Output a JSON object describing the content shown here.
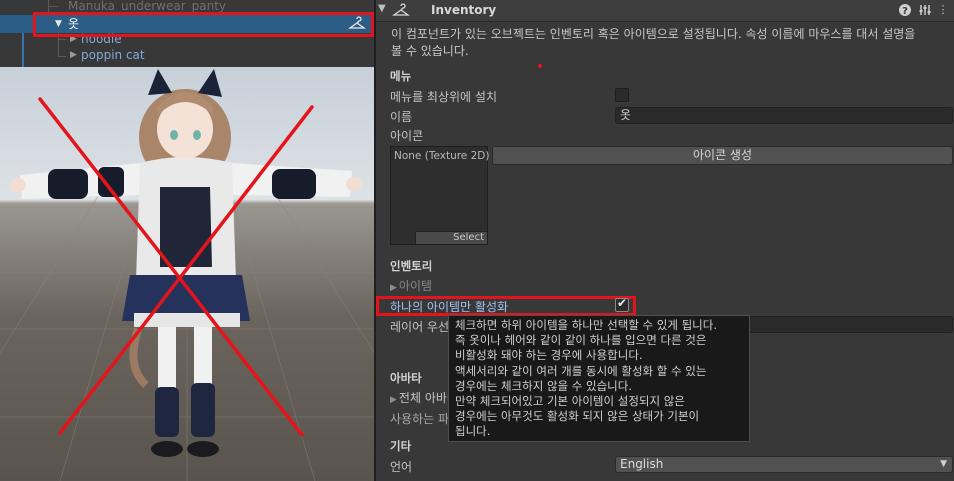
{
  "hierarchy": {
    "items": [
      {
        "label": "Manuka_underwear_panty"
      },
      {
        "label": "옷"
      },
      {
        "label": "hoodie"
      },
      {
        "label": "poppin cat"
      }
    ]
  },
  "inspector": {
    "component_title": "Inventory",
    "description": [
      "이 컴포넌트가 있는 오브젝트는 인벤토리 혹은 아이템으로 설정됩니다. 속성 이름에 마우스를 대서 설명을",
      "볼 수 있습니다."
    ],
    "menu_section": "메뉴",
    "menu_top_label": "메뉴를 최상위에 설치",
    "menu_top_checked": false,
    "name_label": "이름",
    "name_value": "옷",
    "icon_label": "아이콘",
    "texture_value": "None (Texture 2D)",
    "select_label": "Select",
    "generate_icon_button": "아이콘 생성",
    "inventory_section": "인벤토리",
    "items_label": "아이템",
    "single_active_label": "하나의 아이템만 활성화",
    "single_active_checked": true,
    "layer_label": "레이어 우선",
    "avatar_section": "아바타",
    "all_avatars_label": "전체 아바타",
    "used_label": "사용하는 파",
    "misc_section": "기타",
    "language_label": "언어",
    "language_value": "English",
    "tooltip_lines": [
      "체크하면 하위 아이템을 하나만 선택할 수 있게 됩니다.",
      "즉 옷이나 헤어와 같이 같이 하나를 입으면 다른 것은",
      "비활성화 돼야 하는 경우에 사용합니다.",
      "액세서리와 같이 여러 개를 동시에 활성화 할 수 있는",
      "경우에는 체크하지 않을 수 있습니다.",
      "만약 체크되어있고 기본 아이템이 설정되지 않은",
      "경우에는 아무것도 활성화 되지 않은 상태가 기본이",
      "됩니다."
    ]
  },
  "colors": {
    "selection": "#2c5d87",
    "annotation_red": "#e3151b",
    "panel_bg": "#383838"
  },
  "icons": [
    "hanger-icon",
    "help-icon",
    "preset-icon",
    "more-options-icon",
    "foldout-arrow-icon",
    "dropdown-arrow-icon",
    "checkmark-icon"
  ]
}
